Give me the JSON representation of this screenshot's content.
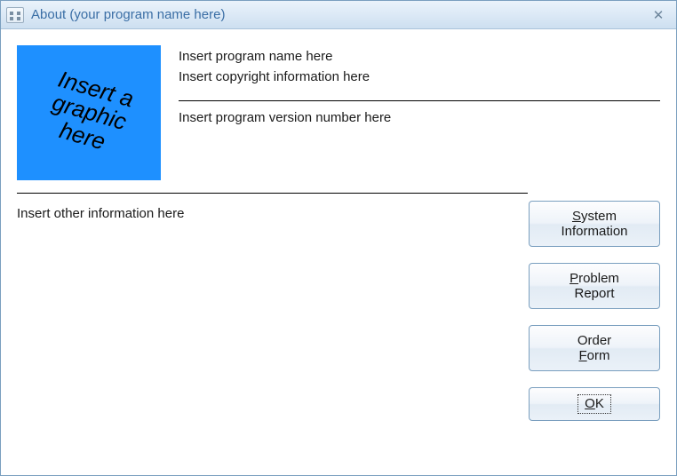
{
  "window": {
    "title": "About (your program name here)"
  },
  "graphic": {
    "line1": "Insert a",
    "line2": "graphic",
    "line3": "here"
  },
  "info": {
    "program_name": "Insert program name here",
    "copyright": "Insert copyright information here",
    "version": "Insert program version number here",
    "other": "Insert other information here"
  },
  "buttons": {
    "system_information": {
      "pre": "",
      "u": "S",
      "post": "ystem\nInformation"
    },
    "problem_report": {
      "pre": "",
      "u": "P",
      "post": "roblem\nReport"
    },
    "order_form": {
      "pre": "Order\n",
      "u": "F",
      "post": "orm"
    },
    "ok": {
      "pre": "",
      "u": "O",
      "post": "K"
    }
  }
}
